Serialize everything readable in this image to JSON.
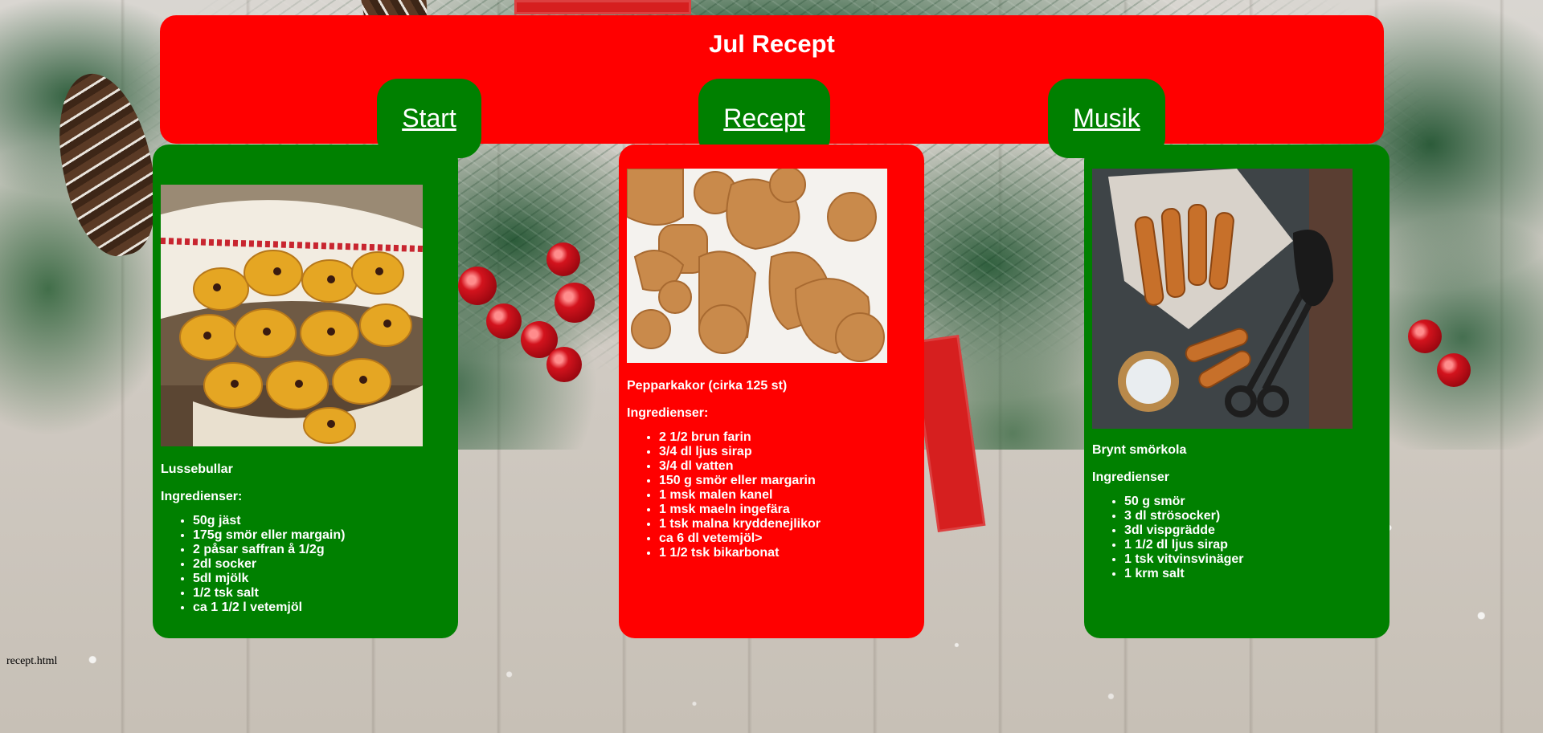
{
  "header": {
    "title": "Jul Recept",
    "nav": [
      {
        "label": "Start"
      },
      {
        "label": "Recept"
      },
      {
        "label": "Musik"
      }
    ]
  },
  "recipes": [
    {
      "name": "Lussebullar",
      "ingredients_label": "Ingredienser:",
      "ingredients": [
        "50g jäst",
        "175g smör eller margain)",
        "2 påsar saffran å 1/2g",
        "2dl socker",
        "5dl mjölk",
        "1/2 tsk salt",
        "ca 1 1/2 l vetemjöl"
      ]
    },
    {
      "name": "Pepparkakor (cirka 125 st)",
      "ingredients_label": "Ingredienser:",
      "ingredients": [
        "2 1/2 brun farin",
        "3/4 dl ljus sirap",
        "3/4 dl vatten",
        "150 g smör eller margarin",
        "1 msk malen kanel",
        "1 msk maeln ingefära",
        "1 tsk malna kryddenejlikor",
        "ca 6 dl vetemjöl>",
        "1 1/2 tsk bikarbonat"
      ]
    },
    {
      "name": "Brynt smörkola",
      "ingredients_label": "Ingredienser",
      "ingredients": [
        "50 g smör",
        "3 dl strösocker)",
        "3dl vispgrädde",
        "1 1/2 dl ljus sirap",
        "1 tsk vitvinsvinäger",
        "1 krm salt"
      ]
    }
  ],
  "footer": {
    "link": "recept.html"
  },
  "colors": {
    "red": "#ff0000",
    "green": "#008000",
    "text": "#ffffff"
  }
}
